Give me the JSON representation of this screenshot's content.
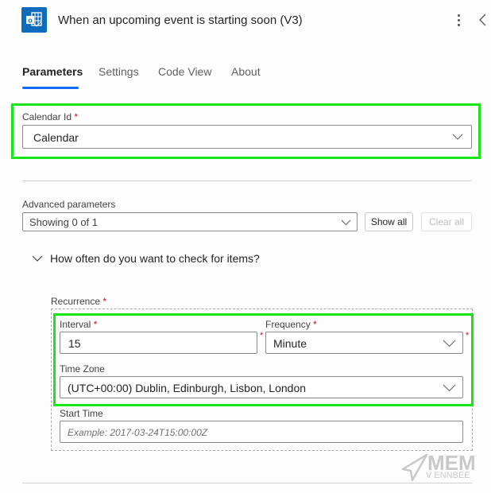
{
  "header": {
    "app_icon": "outlook-icon",
    "title": "When an upcoming event is starting soon (V3)",
    "more_icon": "more-vertical-icon",
    "collapse_icon": "chevron-left-icon"
  },
  "tabs": [
    {
      "label": "Parameters",
      "active": true
    },
    {
      "label": "Settings",
      "active": false
    },
    {
      "label": "Code View",
      "active": false
    },
    {
      "label": "About",
      "active": false
    }
  ],
  "calendar_id": {
    "label": "Calendar Id",
    "required_mark": "*",
    "value": "Calendar"
  },
  "advanced": {
    "label": "Advanced parameters",
    "value": "Showing 0 of 1",
    "show_all": "Show all",
    "clear_all": "Clear all"
  },
  "section": {
    "title": "How often do you want to check for items?",
    "expanded": true
  },
  "recurrence": {
    "label": "Recurrence",
    "required_mark": "*",
    "interval": {
      "label": "Interval",
      "required_mark": "*",
      "value": "15"
    },
    "frequency": {
      "label": "Frequency",
      "required_mark": "*",
      "value": "Minute"
    },
    "time_zone": {
      "label": "Time Zone",
      "value": "(UTC+00:00) Dublin, Edinburgh, Lisbon, London"
    },
    "start_time": {
      "label": "Start Time",
      "placeholder": "Example: 2017-03-24T15:00:00Z"
    }
  },
  "watermark": {
    "title": "MEM",
    "subtitle": "V ENNBEE"
  },
  "colors": {
    "accent": "#0f6cfd",
    "highlight": "#19e619",
    "required": "#c50f1f"
  }
}
